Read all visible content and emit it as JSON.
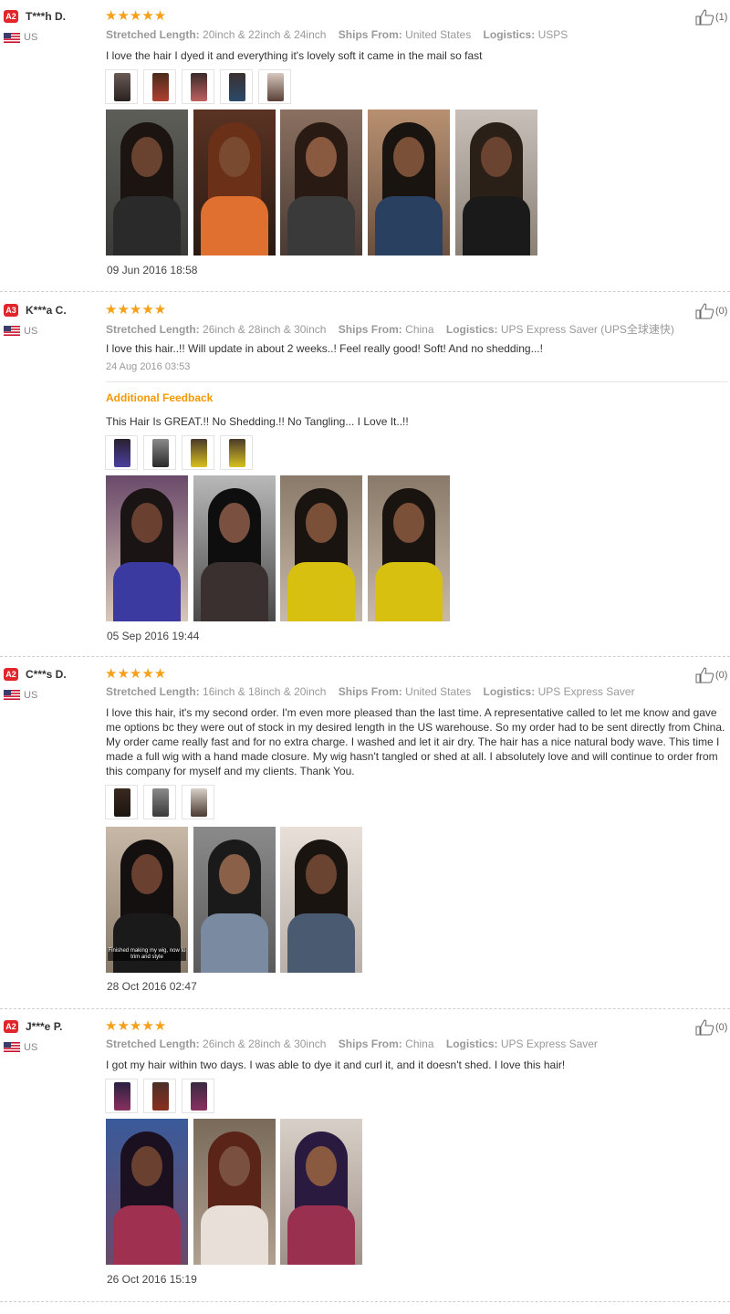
{
  "labels": {
    "stretched_length": "Stretched Length:",
    "ships_from": "Ships From:",
    "logistics": "Logistics:",
    "additional_feedback": "Additional Feedback",
    "stars": "★★★★★"
  },
  "colors": {
    "badge": "#e0252b",
    "stars": "#f5a018",
    "accent": "#f39800"
  },
  "reviews": [
    {
      "badge": "A2",
      "name": "T***h D.",
      "country": "US",
      "length": "20inch & 22inch & 24inch",
      "ships_from": "United States",
      "logistics": "USPS",
      "text": "I love the hair I dyed it and everything it's lovely soft it came in the mail so fast",
      "date": "09 Jun 2016 18:58",
      "likes": "(1)",
      "thumb_count": 5,
      "photo_count": 5
    },
    {
      "badge": "A3",
      "name": "K***a C.",
      "country": "US",
      "length": "26inch & 28inch & 30inch",
      "ships_from": "China",
      "logistics": "UPS Express Saver (UPS全球速快)",
      "text": "I love this hair..!! Will update in about 2 weeks..! Feel really good! Soft! And no shedding...!",
      "first_date": "24 Aug 2016 03:53",
      "additional_text": "This Hair Is GREAT.!! No Shedding.!! No Tangling... I Love It..!!",
      "date": "05 Sep 2016 19:44",
      "likes": "(0)",
      "thumb_count": 4,
      "photo_count": 4
    },
    {
      "badge": "A2",
      "name": "C***s D.",
      "country": "US",
      "length": "16inch & 18inch & 20inch",
      "ships_from": "United States",
      "logistics": "UPS Express Saver",
      "text": "I love this hair, it's my second order. I'm even more pleased than the last time. A representative called to let me know and gave me options bc they were out of stock in my desired length in the US warehouse. So my order had to be sent directly from China. My order came really fast and for no extra charge. I washed and let it air dry. The hair has a nice natural body wave. This time I made a full wig with a hand made closure. My wig hasn't tangled or shed at all. I absolutely love and will continue to order from this company for myself and my clients. Thank You.",
      "photo_caption": "Finished making my wig, now to trim and style",
      "date": "28 Oct 2016 02:47",
      "likes": "(0)",
      "thumb_count": 3,
      "photo_count": 3
    },
    {
      "badge": "A2",
      "name": "J***e P.",
      "country": "US",
      "length": "26inch & 28inch & 30inch",
      "ships_from": "China",
      "logistics": "UPS Express Saver",
      "text": "I got my hair within two days. I was able to dye it and curl it, and it doesn't shed. I love this hair!",
      "date": "26 Oct 2016 15:19",
      "likes": "(0)",
      "thumb_count": 3,
      "photo_count": 3
    }
  ]
}
